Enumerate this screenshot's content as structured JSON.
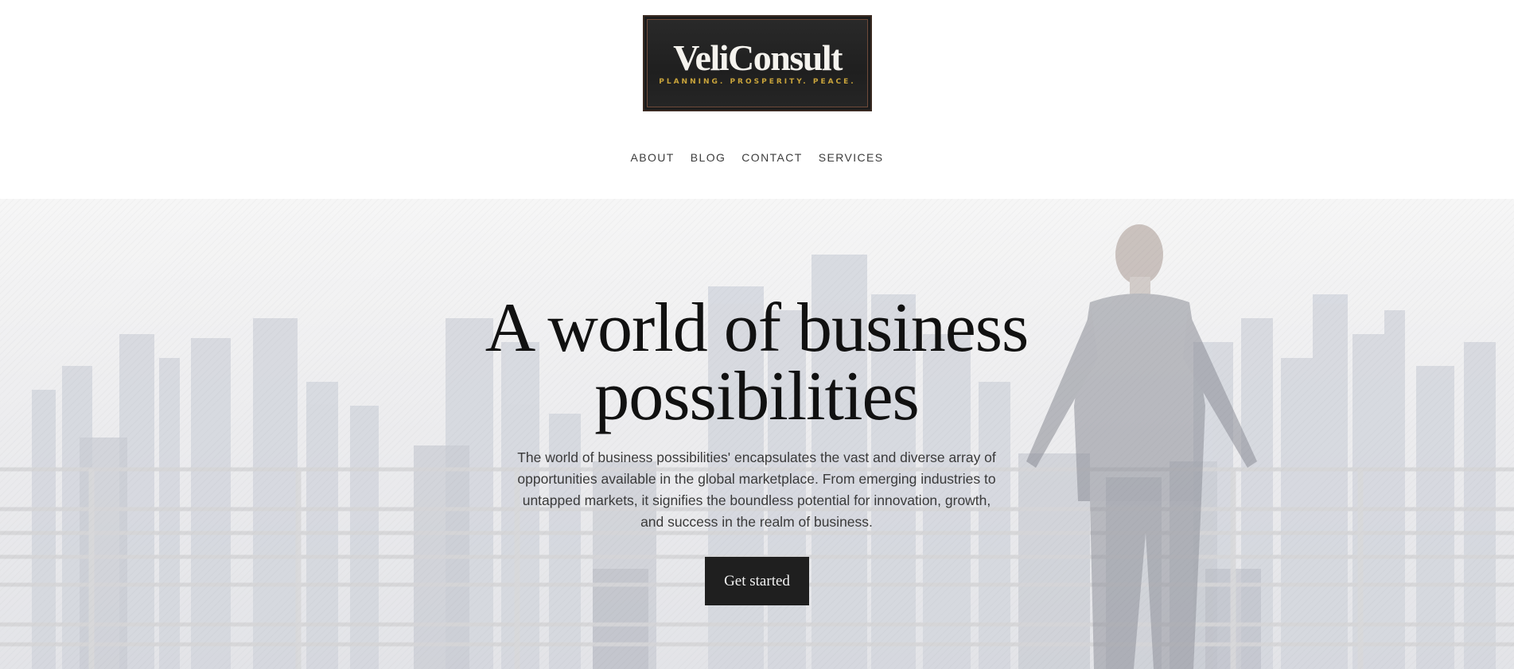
{
  "brand": {
    "name": "VeliConsult",
    "tagline": "PLANNING. PROSPERITY. PEACE.",
    "logo_bg": "#1f1f1f",
    "logo_text_color": "#f5f3ee",
    "tagline_color": "#c9a43b"
  },
  "nav": {
    "items": [
      "ABOUT",
      "BLOG",
      "CONTACT",
      "SERVICES"
    ]
  },
  "hero": {
    "title_line1": "A world of business",
    "title_line2": "possibilities",
    "text": "The world of business possibilities' encapsulates the vast and diverse array of opportunities available in the global marketplace. From emerging industries to untapped markets, it signifies the boundless potential for innovation, growth, and success in the realm of business.",
    "cta_label": "Get started",
    "background_image": "businessman-overlooking-city-skyline"
  }
}
